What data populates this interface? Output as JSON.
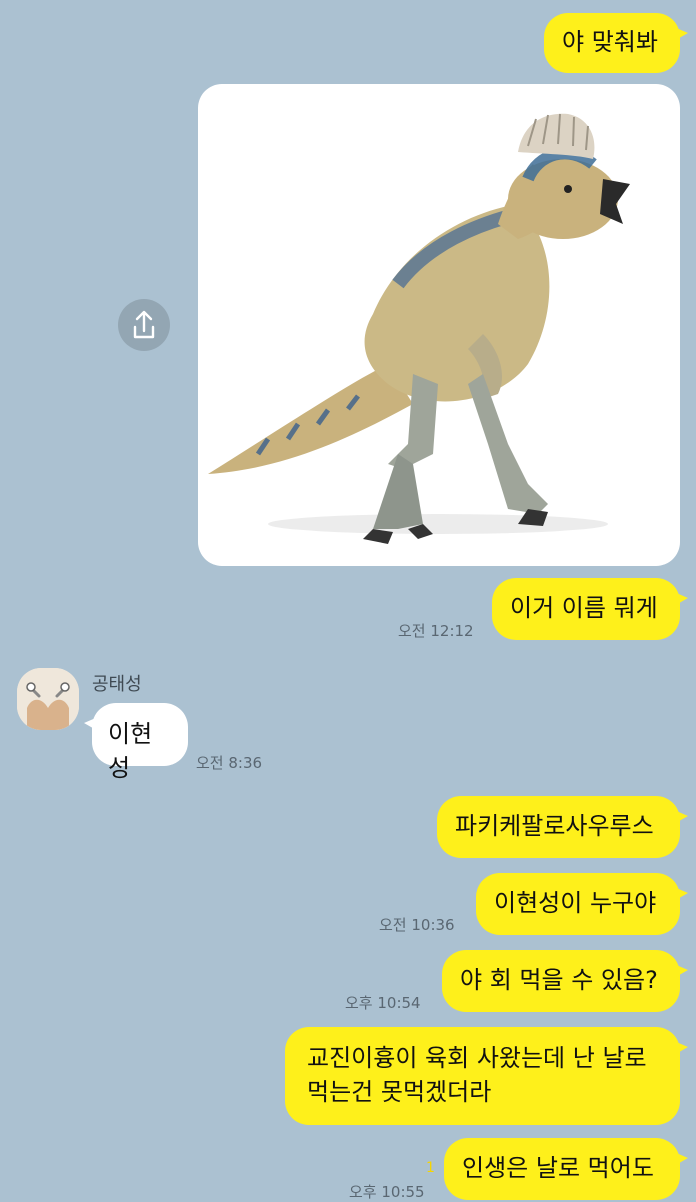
{
  "chat": {
    "sender_name": "공태성",
    "messages": [
      {
        "from": "me",
        "type": "text",
        "text": "야 맞춰봐",
        "time": ""
      },
      {
        "from": "me",
        "type": "image",
        "icon": "dinosaur-photo",
        "time": ""
      },
      {
        "from": "me",
        "type": "text",
        "text": "이거 이름 뭐게",
        "time": "오전 12:12"
      },
      {
        "from": "other",
        "type": "text",
        "text": "이현성",
        "time": "오전 8:36"
      },
      {
        "from": "me",
        "type": "text",
        "text": "파키케팔로사우루스",
        "time": ""
      },
      {
        "from": "me",
        "type": "text",
        "text": "이현성이 누구야",
        "time": "오전 10:36"
      },
      {
        "from": "me",
        "type": "text",
        "text": "야 회 먹을 수 있음?",
        "time": "오후 10:54"
      },
      {
        "from": "me",
        "type": "text",
        "text": "교진이흉이 육회 사왔는데 난 날로\n먹는건 못먹겠더라",
        "time": ""
      },
      {
        "from": "me",
        "type": "text",
        "text": "인생은 날로 먹어도",
        "time": "오후 10:55",
        "unread": "1"
      }
    ]
  },
  "icons": {
    "share": "share-icon",
    "avatar": "avatar-image"
  },
  "colors": {
    "background": "#abc1d1",
    "my_bubble": "#fef01b",
    "their_bubble": "#ffffff"
  }
}
